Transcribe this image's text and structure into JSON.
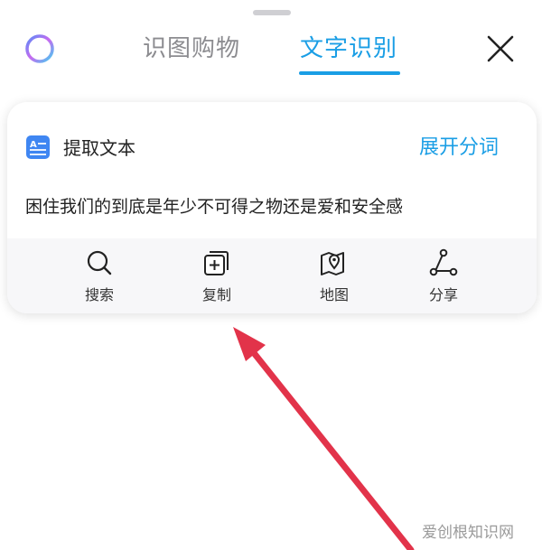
{
  "tabs": {
    "shopping_label": "识图购物",
    "text_recognition_label": "文字识别"
  },
  "card": {
    "header_label": "提取文本",
    "expand_label": "展开分词",
    "recognized_text": "困住我们的到底是年少不可得之物还是爱和安全感"
  },
  "actions": [
    {
      "label": "搜索",
      "icon": "search-icon"
    },
    {
      "label": "复制",
      "icon": "copy-icon"
    },
    {
      "label": "地图",
      "icon": "map-icon"
    },
    {
      "label": "分享",
      "icon": "share-icon"
    }
  ],
  "watermark": "爱创根知识网",
  "colors": {
    "accent": "#1a9ee5",
    "arrow": "#e2334a",
    "inactive_tab": "#8c8c90",
    "doc_icon": "#3f86f2"
  }
}
